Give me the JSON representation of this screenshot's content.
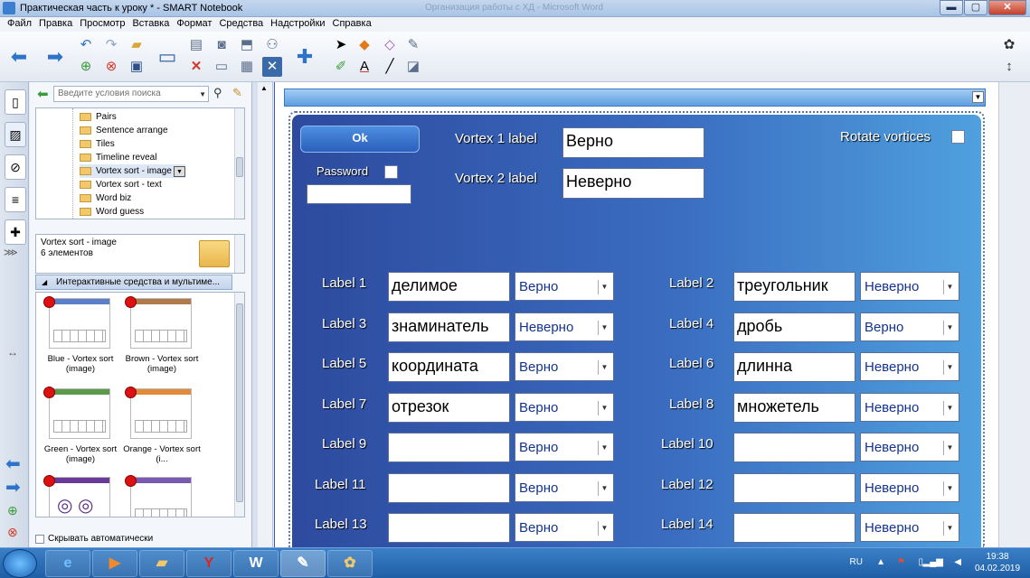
{
  "window": {
    "title": "Практическая часть к уроку * - SMART Notebook",
    "background_title": "Организация работы с ХД - Microsoft Word",
    "buttons": {
      "minimize": "▬",
      "maximize": "▢",
      "close": "✕"
    }
  },
  "menubar": [
    "Файл",
    "Правка",
    "Просмотр",
    "Вставка",
    "Формат",
    "Средства",
    "Надстройки",
    "Справка"
  ],
  "toolbar": {
    "icons": [
      "back-arrow-icon",
      "forward-arrow-icon",
      "undo-icon",
      "redo-icon",
      "open-folder-icon",
      "new-page-icon",
      "delete-page-icon",
      "save-icon",
      "projector-icon",
      "paste-icon",
      "screen-capture-icon",
      "screen-shade-icon",
      "share-icon",
      "delete-icon",
      "display-icon",
      "table-icon",
      "close-x-icon",
      "addon-puzzle-icon",
      "select-arrow-icon",
      "shapes-icon",
      "eraser-icon",
      "magic-pen-icon",
      "pens-icon",
      "text-icon",
      "line-icon",
      "fill-icon",
      "settings-icon",
      "move-toolbar-icon"
    ],
    "text_tool": "A"
  },
  "sidebar": {
    "search_placeholder": "Введите условия поиска",
    "tree_items": [
      "Pairs",
      "Sentence arrange",
      "Tiles",
      "Timeline reveal",
      "Vortex sort - image",
      "Vortex sort - text",
      "Word biz",
      "Word guess"
    ],
    "selected_title": "Vortex sort - image",
    "selected_count": "6 элементов",
    "section_label": "Интерактивные средства и мультиме...",
    "thumbnails": [
      {
        "caption": "Blue - Vortex sort (image)",
        "color": "#5a7fc8"
      },
      {
        "caption": "Brown - Vortex sort (image)",
        "color": "#b07a4a"
      },
      {
        "caption": "Green - Vortex sort (image)",
        "color": "#5a9a4a"
      },
      {
        "caption": "Orange - Vortex sort (i...",
        "color": "#e08a3a"
      },
      {
        "caption": "",
        "color": "#6a3a9a"
      },
      {
        "caption": "",
        "color": "#7a5ab0"
      }
    ],
    "autohide": "Скрывать автоматически"
  },
  "widget": {
    "ok_label": "Ok",
    "password_label": "Password",
    "vortex1_label": "Vortex 1 label",
    "vortex1_value": "Верно",
    "vortex2_label": "Vortex 2 label",
    "vortex2_value": "Неверно",
    "rotate_label": "Rotate vortices",
    "rows": [
      {
        "l_label": "Label 1",
        "l_text": "делимое",
        "l_sel": "Верно",
        "r_label": "Label 2",
        "r_text": "треугольник",
        "r_sel": "Неверно"
      },
      {
        "l_label": "Label 3",
        "l_text": "знаминатель",
        "l_sel": "Неверно",
        "r_label": "Label 4",
        "r_text": "дробь",
        "r_sel": "Верно"
      },
      {
        "l_label": "Label 5",
        "l_text": "координата",
        "l_sel": "Верно",
        "r_label": "Label 6",
        "r_text": "длинна",
        "r_sel": "Неверно"
      },
      {
        "l_label": "Label 7",
        "l_text": "отрезок",
        "l_sel": "Верно",
        "r_label": "Label 8",
        "r_text": "множетель",
        "r_sel": "Неверно"
      },
      {
        "l_label": "Label 9",
        "l_text": "",
        "l_sel": "Верно",
        "r_label": "Label 10",
        "r_text": "",
        "r_sel": "Неверно"
      },
      {
        "l_label": "Label 11",
        "l_text": "",
        "l_sel": "Верно",
        "r_label": "Label 12",
        "r_text": "",
        "r_sel": "Неверно"
      },
      {
        "l_label": "Label 13",
        "l_text": "",
        "l_sel": "Верно",
        "r_label": "Label 14",
        "r_text": "",
        "r_sel": "Неверно"
      }
    ]
  },
  "taskbar": {
    "apps": [
      "internet-explorer-icon",
      "media-player-icon",
      "file-explorer-icon",
      "yandex-browser-icon",
      "word-icon",
      "smart-notebook-icon",
      "paint-icon"
    ],
    "language": "RU",
    "time": "19:38",
    "date": "04.02.2019"
  }
}
